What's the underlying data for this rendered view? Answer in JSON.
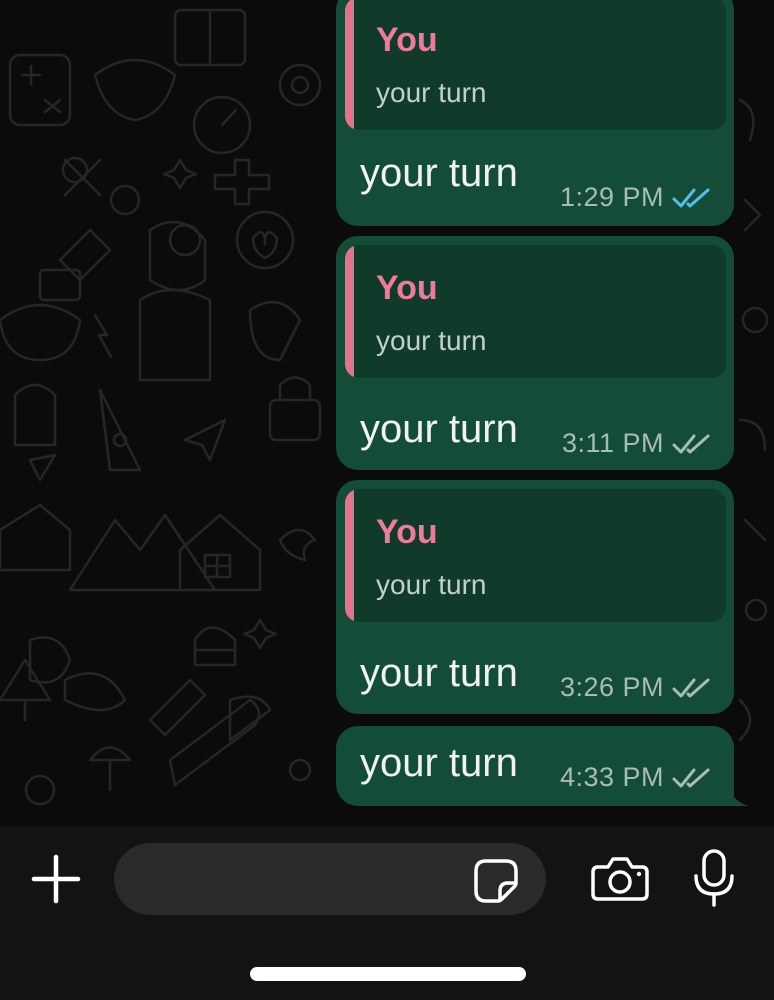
{
  "messages": [
    {
      "quote": {
        "author": "You",
        "text": "your turn"
      },
      "text": "your turn",
      "time": "1:29 PM",
      "status": "read",
      "status_icon": "double-check-icon",
      "status_color": "#53bdeb"
    },
    {
      "quote": {
        "author": "You",
        "text": "your turn"
      },
      "text": "your turn",
      "time": "3:11 PM",
      "status": "delivered",
      "status_icon": "double-check-icon",
      "status_color": "#a9bcb2"
    },
    {
      "quote": {
        "author": "You",
        "text": "your turn"
      },
      "text": "your turn",
      "time": "3:26 PM",
      "status": "delivered",
      "status_icon": "double-check-icon",
      "status_color": "#a9bcb2"
    },
    {
      "text": "your turn",
      "time": "4:33 PM",
      "status": "delivered",
      "status_icon": "double-check-icon",
      "status_color": "#a9bcb2"
    }
  ],
  "composer": {
    "placeholder": "",
    "icons": [
      "plus-icon",
      "sticker-icon",
      "camera-icon",
      "microphone-icon"
    ]
  },
  "colors": {
    "bubble": "#144d37",
    "quote_bg": "#103b2a",
    "quote_accent": "#e5728f",
    "author": "#f07a9b",
    "read_ticks": "#53bdeb"
  }
}
